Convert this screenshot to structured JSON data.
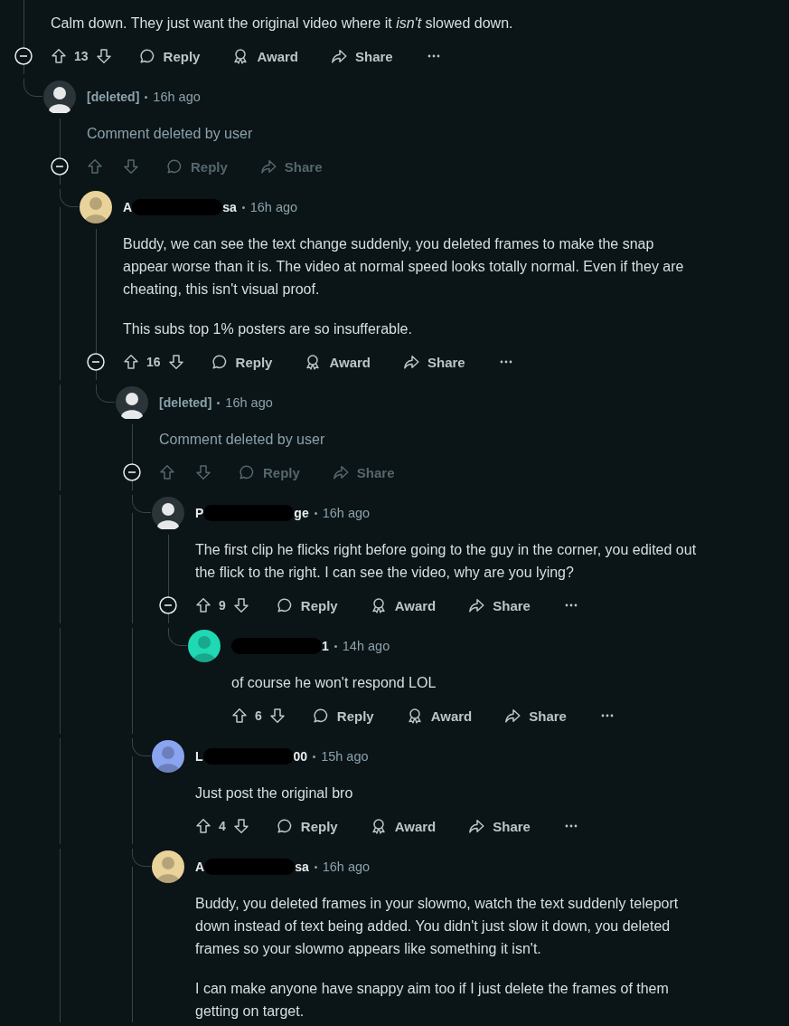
{
  "comments": [
    {
      "body": [
        "Calm down. They just want the original video where it *isn't* slowed down."
      ],
      "deleted": false,
      "expanded": true,
      "actions": {
        "score": "13",
        "reply": "Reply",
        "award": "Award",
        "share": "Share"
      },
      "replies": [
        {
          "author": {
            "kind": "deleted",
            "name": "[deleted]"
          },
          "avatar": {
            "color": "#2b3438"
          },
          "time": "16h ago",
          "body": [
            "Comment deleted by user"
          ],
          "deleted": true,
          "expanded": true,
          "continues_below": true,
          "actions": {
            "reply": "Reply",
            "share": "Share"
          },
          "replies": [
            {
              "author": {
                "kind": "redacted",
                "start": "A",
                "end": "sa"
              },
              "avatar": {
                "color": "#e9d39a"
              },
              "time": "16h ago",
              "body": [
                "Buddy, we can see the text change suddenly, you deleted frames to make the snap appear worse than it is. The video at normal speed looks totally normal. Even if they are cheating, this isn't visual proof.",
                "This subs top 1% posters are so insufferable."
              ],
              "deleted": false,
              "expanded": true,
              "actions": {
                "score": "16",
                "reply": "Reply",
                "award": "Award",
                "share": "Share"
              },
              "replies": [
                {
                  "author": {
                    "kind": "deleted",
                    "name": "[deleted]"
                  },
                  "avatar": {
                    "color": "#2b3438"
                  },
                  "time": "16h ago",
                  "body": [
                    "Comment deleted by user"
                  ],
                  "deleted": true,
                  "expanded": true,
                  "continues_below": true,
                  "actions": {
                    "reply": "Reply",
                    "share": "Share"
                  },
                  "replies": [
                    {
                      "author": {
                        "kind": "redacted",
                        "start": "P",
                        "end": "ge"
                      },
                      "avatar": {
                        "color": "#2b3438"
                      },
                      "time": "16h ago",
                      "body": [
                        "The first clip he flicks right before going to the guy in the corner, you edited out the flick to the right. I can see the video, why are you lying?"
                      ],
                      "deleted": false,
                      "expanded": true,
                      "actions": {
                        "score": "9",
                        "reply": "Reply",
                        "award": "Award",
                        "share": "Share"
                      },
                      "replies": [
                        {
                          "author": {
                            "kind": "redacted",
                            "end": "1"
                          },
                          "avatar": {
                            "color": "#1fd8b4"
                          },
                          "time": "14h ago",
                          "body": [
                            "of course he won't respond LOL"
                          ],
                          "deleted": false,
                          "actions": {
                            "score": "6",
                            "reply": "Reply",
                            "award": "Award",
                            "share": "Share"
                          }
                        }
                      ]
                    },
                    {
                      "author": {
                        "kind": "redacted",
                        "start": "L",
                        "end": "00"
                      },
                      "avatar": {
                        "color": "#8aa4f0"
                      },
                      "time": "15h ago",
                      "body": [
                        "Just post the original bro"
                      ],
                      "deleted": false,
                      "actions": {
                        "score": "4",
                        "reply": "Reply",
                        "award": "Award",
                        "share": "Share"
                      }
                    },
                    {
                      "author": {
                        "kind": "redacted",
                        "start": "A",
                        "end": "sa"
                      },
                      "avatar": {
                        "color": "#e9d39a"
                      },
                      "time": "16h ago",
                      "body": [
                        "Buddy, you deleted frames in your slowmo, watch the text suddenly teleport down instead of text being added. You didn't just slow it down, you deleted frames so your slowmo appears like something it isn't.",
                        "I can make anyone have snappy aim too if I just delete the frames of them getting on target."
                      ],
                      "deleted": false
                    }
                  ]
                }
              ]
            }
          ]
        }
      ]
    }
  ]
}
